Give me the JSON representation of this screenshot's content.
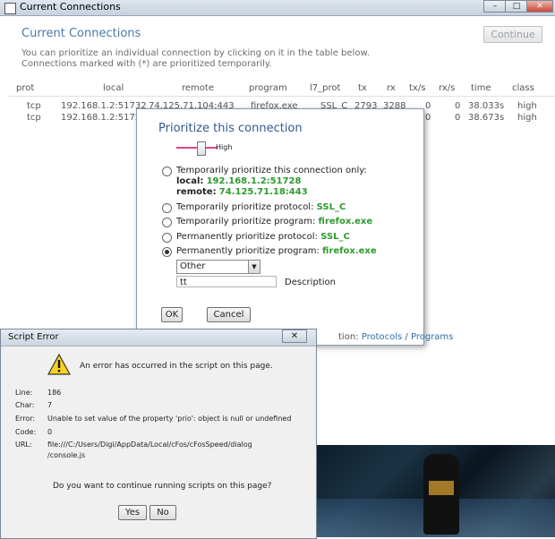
{
  "window": {
    "title": "Current Connections",
    "controls": [
      "–",
      "□",
      "✕"
    ]
  },
  "header": {
    "caption": "Current Connections",
    "continue_label": "Continue",
    "info_line1": "You can prioritize an individual connection by clicking on it in the table below.",
    "info_line2": "Connections marked with (*) are prioritized temporarily."
  },
  "table": {
    "columns": [
      "prot",
      "local",
      "remote",
      "program",
      "l7_prot",
      "tx",
      "rx",
      "tx/s",
      "rx/s",
      "time",
      "class"
    ],
    "rows": [
      {
        "prot": "tcp",
        "local": "192.168.1.2:51732",
        "remote": "74.125.71.104:443",
        "program": "firefox.exe",
        "l7_prot": "SSL_C",
        "tx": "2793",
        "rx": "3288",
        "txs": "0",
        "rxs": "0",
        "time": "38.033s",
        "class": "high"
      },
      {
        "prot": "tcp",
        "local": "192.168.1.2:51728",
        "remote": "",
        "program": "",
        "l7_prot": "",
        "tx": "",
        "rx": "",
        "txs": "0",
        "rxs": "0",
        "time": "38.673s",
        "class": "high"
      }
    ]
  },
  "prioritize": {
    "title": "Prioritize this connection",
    "slider_label": "High",
    "slider_level": 0.75,
    "options": [
      {
        "label": "Temporarily prioritize this connection only:",
        "local_label": "local:",
        "local_value": "192.168.1.2:51728",
        "remote_label": "remote:",
        "remote_value": "74.125.71.18:443",
        "checked": false
      },
      {
        "label": "Temporarily prioritize protocol:",
        "value": "SSL_C",
        "checked": false
      },
      {
        "label": "Temporarily prioritize program:",
        "value": "firefox.exe",
        "checked": false
      },
      {
        "label": "Permanently prioritize protocol:",
        "value": "SSL_C",
        "checked": false
      },
      {
        "label": "Permanently prioritize program:",
        "value": "firefox.exe",
        "checked": true
      }
    ],
    "class_select": "Other",
    "description_value": "tt",
    "description_label": "Description",
    "ok_label": "OK",
    "cancel_label": "Cancel",
    "links_prefix": "tion:",
    "link_protocols": "Protocols",
    "link_separator": "/",
    "link_programs": "Programs",
    "green_color": "#2f9a2f"
  },
  "script_error": {
    "title": "Script Error",
    "close_label": "✕",
    "message": "An error has occurred in the script on this page.",
    "details": [
      {
        "key": "Line:",
        "value": "186"
      },
      {
        "key": "Char:",
        "value": "7"
      },
      {
        "key": "Error:",
        "value": "Unable to set value of the property 'prio': object is null or undefined"
      },
      {
        "key": "Code:",
        "value": "0"
      },
      {
        "key": "URL:",
        "value": "file:///C:/Users/Digi/AppData/Local/cFos/cFosSpeed/dialog"
      }
    ],
    "url_cont": "/console.js",
    "question": "Do you want to continue running scripts on this page?",
    "yes_label": "Yes",
    "no_label": "No",
    "warning_icon": "warning-icon"
  }
}
